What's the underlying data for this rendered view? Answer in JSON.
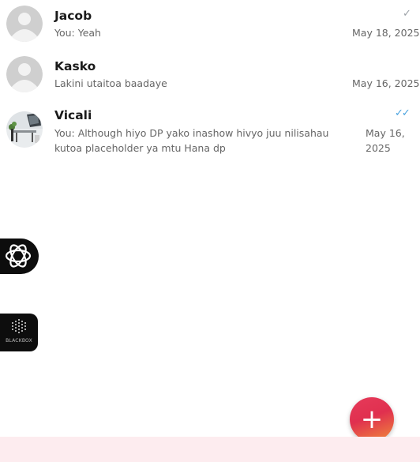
{
  "chats": [
    {
      "name": "Jacob",
      "preview": "You: Yeah",
      "date": "May 18, 2025",
      "status_icon": "check-icon"
    },
    {
      "name": "Kasko",
      "preview": "Lakini utaitoa baadaye",
      "date": "May 16, 2025"
    },
    {
      "name": "Vicali",
      "preview": "You: Although hiyo DP yako inashow hivyo juu nilisahau kutoa placeholder ya mtu Hana dp",
      "date": "May 16, 2025",
      "status_icon": "double-check-icon"
    }
  ],
  "floating": {
    "ai_icon": "openai-icon",
    "blackbox_label": "BLACKBOX"
  },
  "fab": {
    "label": "+"
  },
  "colors": {
    "fab_start": "#e0304f",
    "fab_end": "#f08a3a",
    "read_tick": "#4aa3df",
    "bottom_bar": "#fdecef"
  }
}
